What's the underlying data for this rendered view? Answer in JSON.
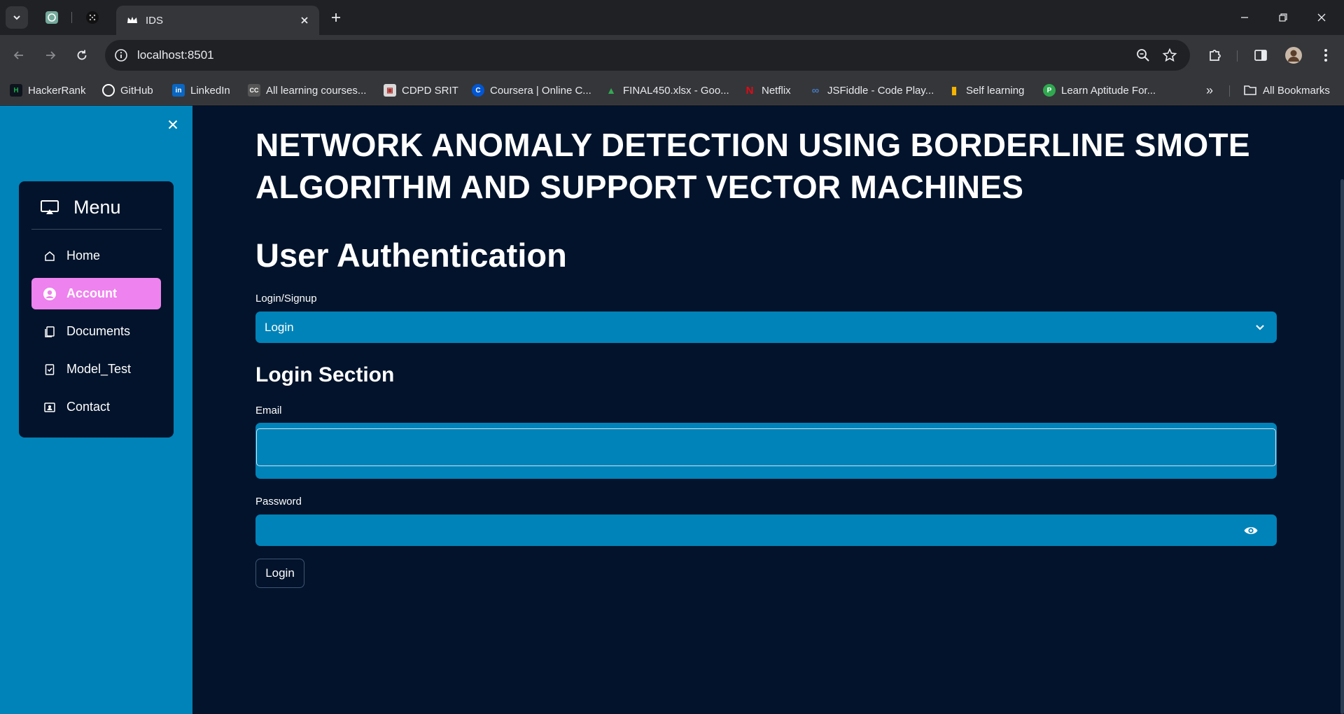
{
  "browser": {
    "active_tab_title": "IDS",
    "url": "localhost:8501",
    "bookmarks": [
      {
        "label": "HackerRank",
        "color": "#1ba94c",
        "glyph": "H"
      },
      {
        "label": "GitHub",
        "color": "#ffffff",
        "glyph": "◉"
      },
      {
        "label": "LinkedIn",
        "color": "#0a66c2",
        "glyph": "in"
      },
      {
        "label": "All learning courses...",
        "color": "#888888",
        "glyph": "CC"
      },
      {
        "label": "CDPD SRIT",
        "color": "#d9d9d9",
        "glyph": "▣"
      },
      {
        "label": "Coursera | Online C...",
        "color": "#0056d2",
        "glyph": "C"
      },
      {
        "label": "FINAL450.xlsx - Goo...",
        "color": "#34a853",
        "glyph": "▲"
      },
      {
        "label": "Netflix",
        "color": "#e50914",
        "glyph": "N"
      },
      {
        "label": "JSFiddle - Code Play...",
        "color": "#4679bd",
        "glyph": "∞"
      },
      {
        "label": "Self learning",
        "color": "#f4b400",
        "glyph": "|"
      },
      {
        "label": "Learn Aptitude For...",
        "color": "#2fa84f",
        "glyph": "P"
      }
    ],
    "all_bookmarks_label": "All Bookmarks"
  },
  "sidebar": {
    "menu_title": "Menu",
    "items": [
      {
        "label": "Home",
        "icon": "house-icon",
        "active": false
      },
      {
        "label": "Account",
        "icon": "person-circle-icon",
        "active": true
      },
      {
        "label": "Documents",
        "icon": "documents-icon",
        "active": false
      },
      {
        "label": "Model_Test",
        "icon": "clipboard-check-icon",
        "active": false
      },
      {
        "label": "Contact",
        "icon": "contact-card-icon",
        "active": false
      }
    ],
    "colors": {
      "sidebar_bg": "#0083b8",
      "active_item": "#ee82ee",
      "card_bg": "#02132b"
    }
  },
  "main": {
    "title": "NETWORK ANOMALY DETECTION USING BORDERLINE SMOTE ALGORITHM AND SUPPORT VECTOR MACHINES",
    "auth_heading": "User Authentication",
    "mode_label": "Login/Signup",
    "mode_value": "Login",
    "login_heading": "Login Section",
    "email_label": "Email",
    "email_value": "",
    "password_label": "Password",
    "password_value": "",
    "login_button": "Login",
    "colors": {
      "page_bg": "#02132b",
      "widget_bg": "#0083b8",
      "text": "#ffffff"
    }
  }
}
